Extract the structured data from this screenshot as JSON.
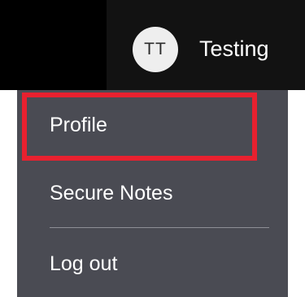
{
  "header": {
    "avatar_initials": "TT",
    "username": "Testing"
  },
  "menu": {
    "items": [
      {
        "label": "Profile",
        "highlighted": true
      },
      {
        "label": "Secure Notes"
      },
      {
        "label": "Log out"
      }
    ]
  },
  "colors": {
    "header_bg": "#000000",
    "menu_bg": "#4a4b53",
    "highlight_border": "#e8212f"
  }
}
